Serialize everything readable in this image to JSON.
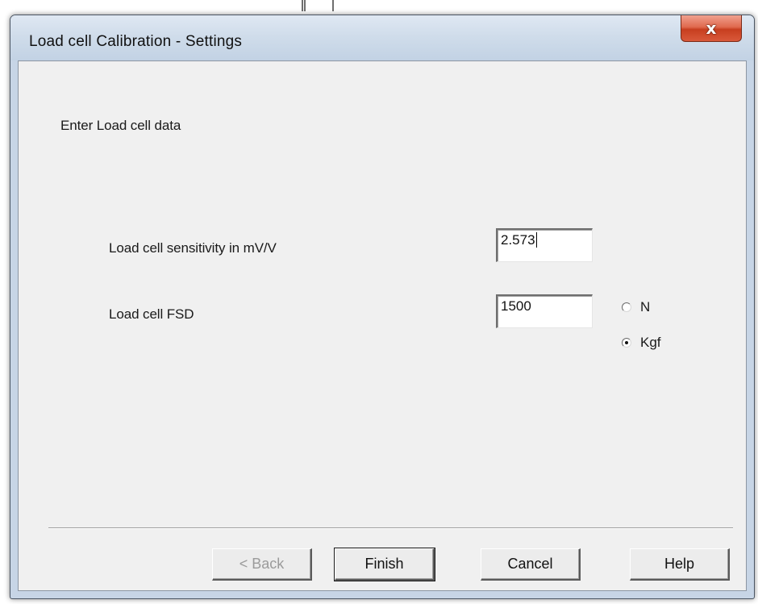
{
  "window": {
    "title": "Load cell Calibration - Settings",
    "close_label": "x"
  },
  "dialog": {
    "heading": "Enter Load cell data",
    "sensitivity": {
      "label": "Load cell sensitivity in mV/V",
      "value": "2.573"
    },
    "fsd": {
      "label": "Load cell FSD",
      "value": "1500"
    },
    "units": {
      "options": [
        {
          "label": "N",
          "checked": false
        },
        {
          "label": "Kgf",
          "checked": true
        }
      ]
    }
  },
  "buttons": {
    "back": "< Back",
    "finish": "Finish",
    "cancel": "Cancel",
    "help": "Help"
  }
}
